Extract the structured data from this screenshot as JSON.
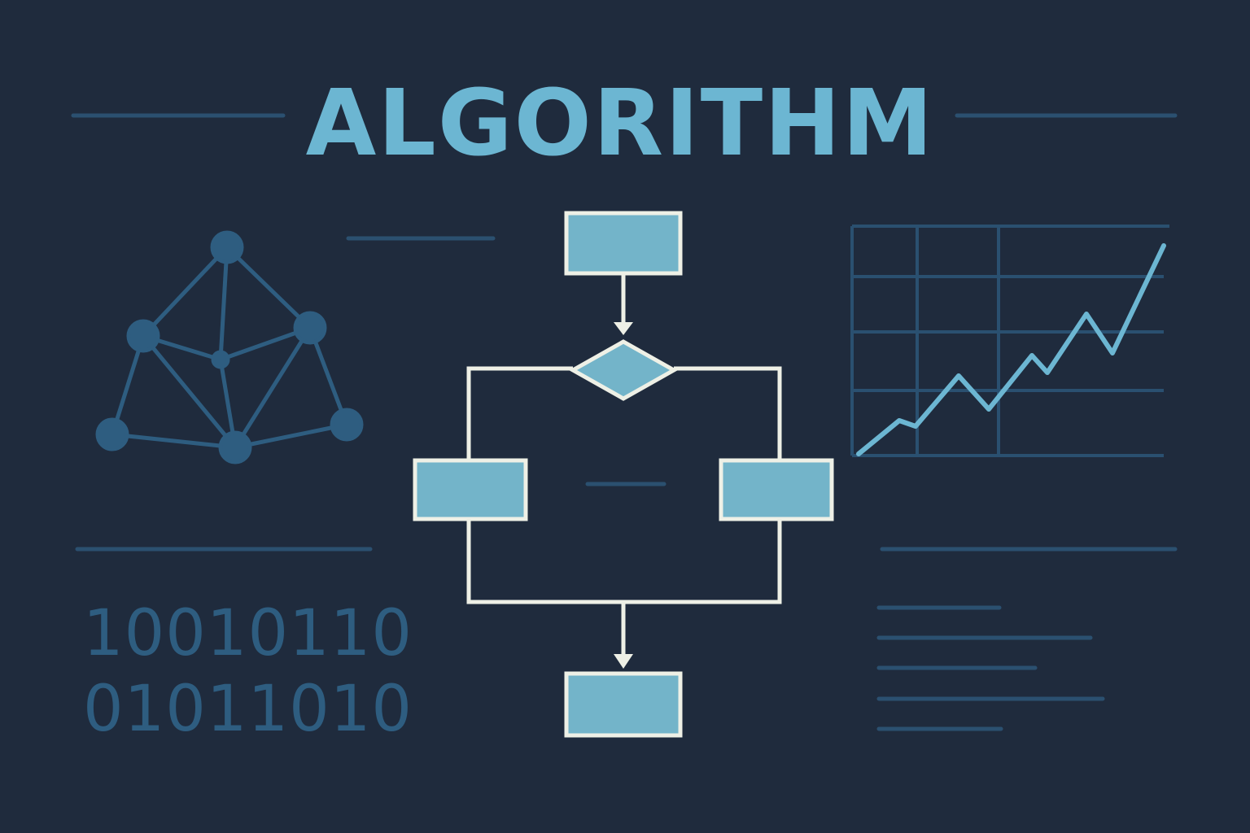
{
  "title": "ALGORITHM",
  "binary": {
    "line1": "10010110",
    "line2": "01011010"
  },
  "colors": {
    "background": "#1f2b3d",
    "title": "#6cb6d2",
    "box_fill": "#73b4c9",
    "box_border": "#eef0e6",
    "connector": "#eef0e6",
    "graph": "#2e5d80",
    "grid": "#2a5070",
    "trend": "#6cb6d2",
    "deco_line": "#2b5070",
    "binary": "#2e5d80"
  },
  "icons": {
    "network": "network-graph-icon",
    "chart": "line-chart-icon",
    "flowchart": "flowchart-icon"
  }
}
